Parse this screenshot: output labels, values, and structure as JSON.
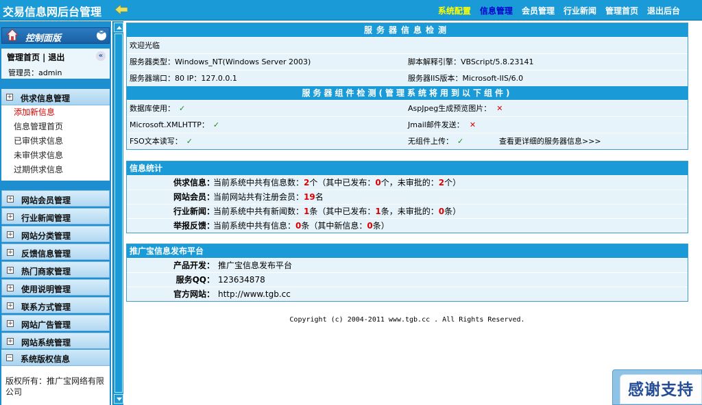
{
  "app": {
    "title": "交易信息网后台管理"
  },
  "topnav": [
    {
      "label": "系统配置",
      "state": "yellow"
    },
    {
      "label": "信息管理",
      "state": "blue"
    },
    {
      "label": "会员管理",
      "state": "normal"
    },
    {
      "label": "行业新闻",
      "state": "normal"
    },
    {
      "label": "管理首页",
      "state": "normal"
    },
    {
      "label": "退出后台",
      "state": "normal"
    }
  ],
  "sidebar": {
    "panel_title": "控制面版",
    "home_link": "管理首页",
    "separator": "|",
    "logout_link": "退出",
    "admin_label": "管理员：admin",
    "open_group": {
      "title": "供求信息管理",
      "items": [
        "添加新信息",
        "信息管理首页",
        "已审供求信息",
        "未审供求信息",
        "过期供求信息"
      ]
    },
    "closed_groups": [
      "网站会员管理",
      "行业新闻管理",
      "网站分类管理",
      "反馈信息管理",
      "热门商家管理",
      "使用说明管理",
      "联系方式管理",
      "网站广告管理",
      "网站系统管理"
    ],
    "last_group": {
      "title": "系统版权信息",
      "body": "版权所有：推广宝网络有限公司"
    }
  },
  "server_panel": {
    "title": "服务器信息检测",
    "welcome": "欢迎光临",
    "server_type": "服务器类型：Windows_NT(Windows Server 2003)",
    "script_engine": "脚本解释引擎：VBScript/5.8.23141",
    "port_ip": "服务器端口：80  IP：127.0.0.1",
    "iis_version": "服务器IIS版本：Microsoft-IIS/6.0",
    "components_title": "服务器组件检测(管理系统将用到以下组件)",
    "db_label": "数据库使用：",
    "aspjpeg_label": "AspJpeg生成预览图片：",
    "xmlhttp_label": "Microsoft.XMLHTTP：",
    "jmail_label": "Jmail邮件发送：",
    "fso_label": "FSO文本读写：",
    "upload_label": "无组件上传：",
    "more_link": "查看更详细的服务器信息>>>",
    "check_mark": "✓",
    "cross_mark": "✕"
  },
  "stats_panel": {
    "title": "信息统计",
    "rows": [
      {
        "key": "供求信息：",
        "p1": "当前系统中共有信息数：",
        "n1": "2",
        "p2": "个（其中已发布：",
        "n2": "0",
        "p3": "个，未审批的：",
        "n3": "2",
        "p4": "个）"
      },
      {
        "key": "网站会员：",
        "p1": "当前网站共有注册会员：",
        "n1": "19",
        "p2": "名",
        "n2": "",
        "p3": "",
        "n3": "",
        "p4": ""
      },
      {
        "key": "行业新闻：",
        "p1": "当前系统中共有新闻数：",
        "n1": "1",
        "p2": "条（其中已发布：",
        "n2": "1",
        "p3": "条，未审批的：",
        "n3": "0",
        "p4": "条）"
      },
      {
        "key": "举报反馈：",
        "p1": "当前系统中共有信息：",
        "n1": "0",
        "p2": "条（其中新信息：",
        "n2": "0",
        "p3": "条）",
        "n3": "",
        "p4": ""
      }
    ]
  },
  "platform_panel": {
    "title": "推广宝信息发布平台",
    "rows": [
      {
        "key": "产品开发：",
        "value": "推广宝信息发布平台"
      },
      {
        "key": "服务QQ：",
        "value": "123634878"
      },
      {
        "key": "官方网站：",
        "value": "http://www.tgb.cc"
      }
    ]
  },
  "copyright": "Copyright (c) 2004-2011 www.tgb.cc . All Rights Reserved.",
  "thanks_badge": "感谢支持",
  "colors": {
    "header_blue": "#1a9bd7",
    "row_bg": "#e6f3fa",
    "accent_red": "#dd0000",
    "check_green": "#1a8a1a"
  }
}
